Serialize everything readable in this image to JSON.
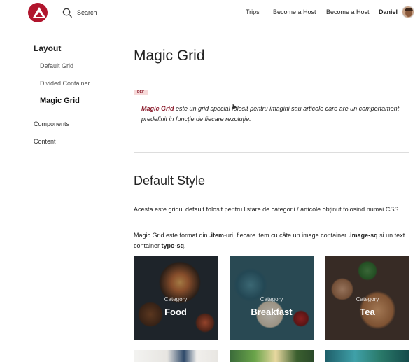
{
  "header": {
    "search_label": "Search",
    "nav": [
      "Trips",
      "Become a Host",
      "Become a Host"
    ],
    "user_name": "Daniel"
  },
  "sidebar": {
    "heading": "Layout",
    "items": [
      {
        "label": "Default Grid",
        "active": false
      },
      {
        "label": "Divided Container",
        "active": false
      },
      {
        "label": "Magic Grid",
        "active": true
      }
    ],
    "sections": [
      "Components",
      "Content"
    ]
  },
  "main": {
    "title": "Magic Grid",
    "definition": {
      "tag": "DEF",
      "term": "Magic Grid",
      "text": " este un grid special folosit pentru imagini sau articole care are un comportament predefinit in funcție de fiecare rezoluție."
    },
    "section_title": "Default Style",
    "para1": "Acesta este gridul default folosit pentru listare de categorii / articole obținut folosind numai CSS.",
    "para2": {
      "t1": "Magic Grid este format din ",
      "b1": ".item",
      "t2": "-uri, fiecare item cu câte un image container ",
      "b2": ".image-sq",
      "t3": " și un text container ",
      "b3": "typo-sq",
      "t4": "."
    },
    "cards": [
      {
        "category": "Category",
        "name": "Food"
      },
      {
        "category": "Category",
        "name": "Breakfast"
      },
      {
        "category": "Category",
        "name": "Tea"
      }
    ]
  },
  "colors": {
    "accent": "#b1152d",
    "def_tag_bg": "#f6d9d9"
  }
}
